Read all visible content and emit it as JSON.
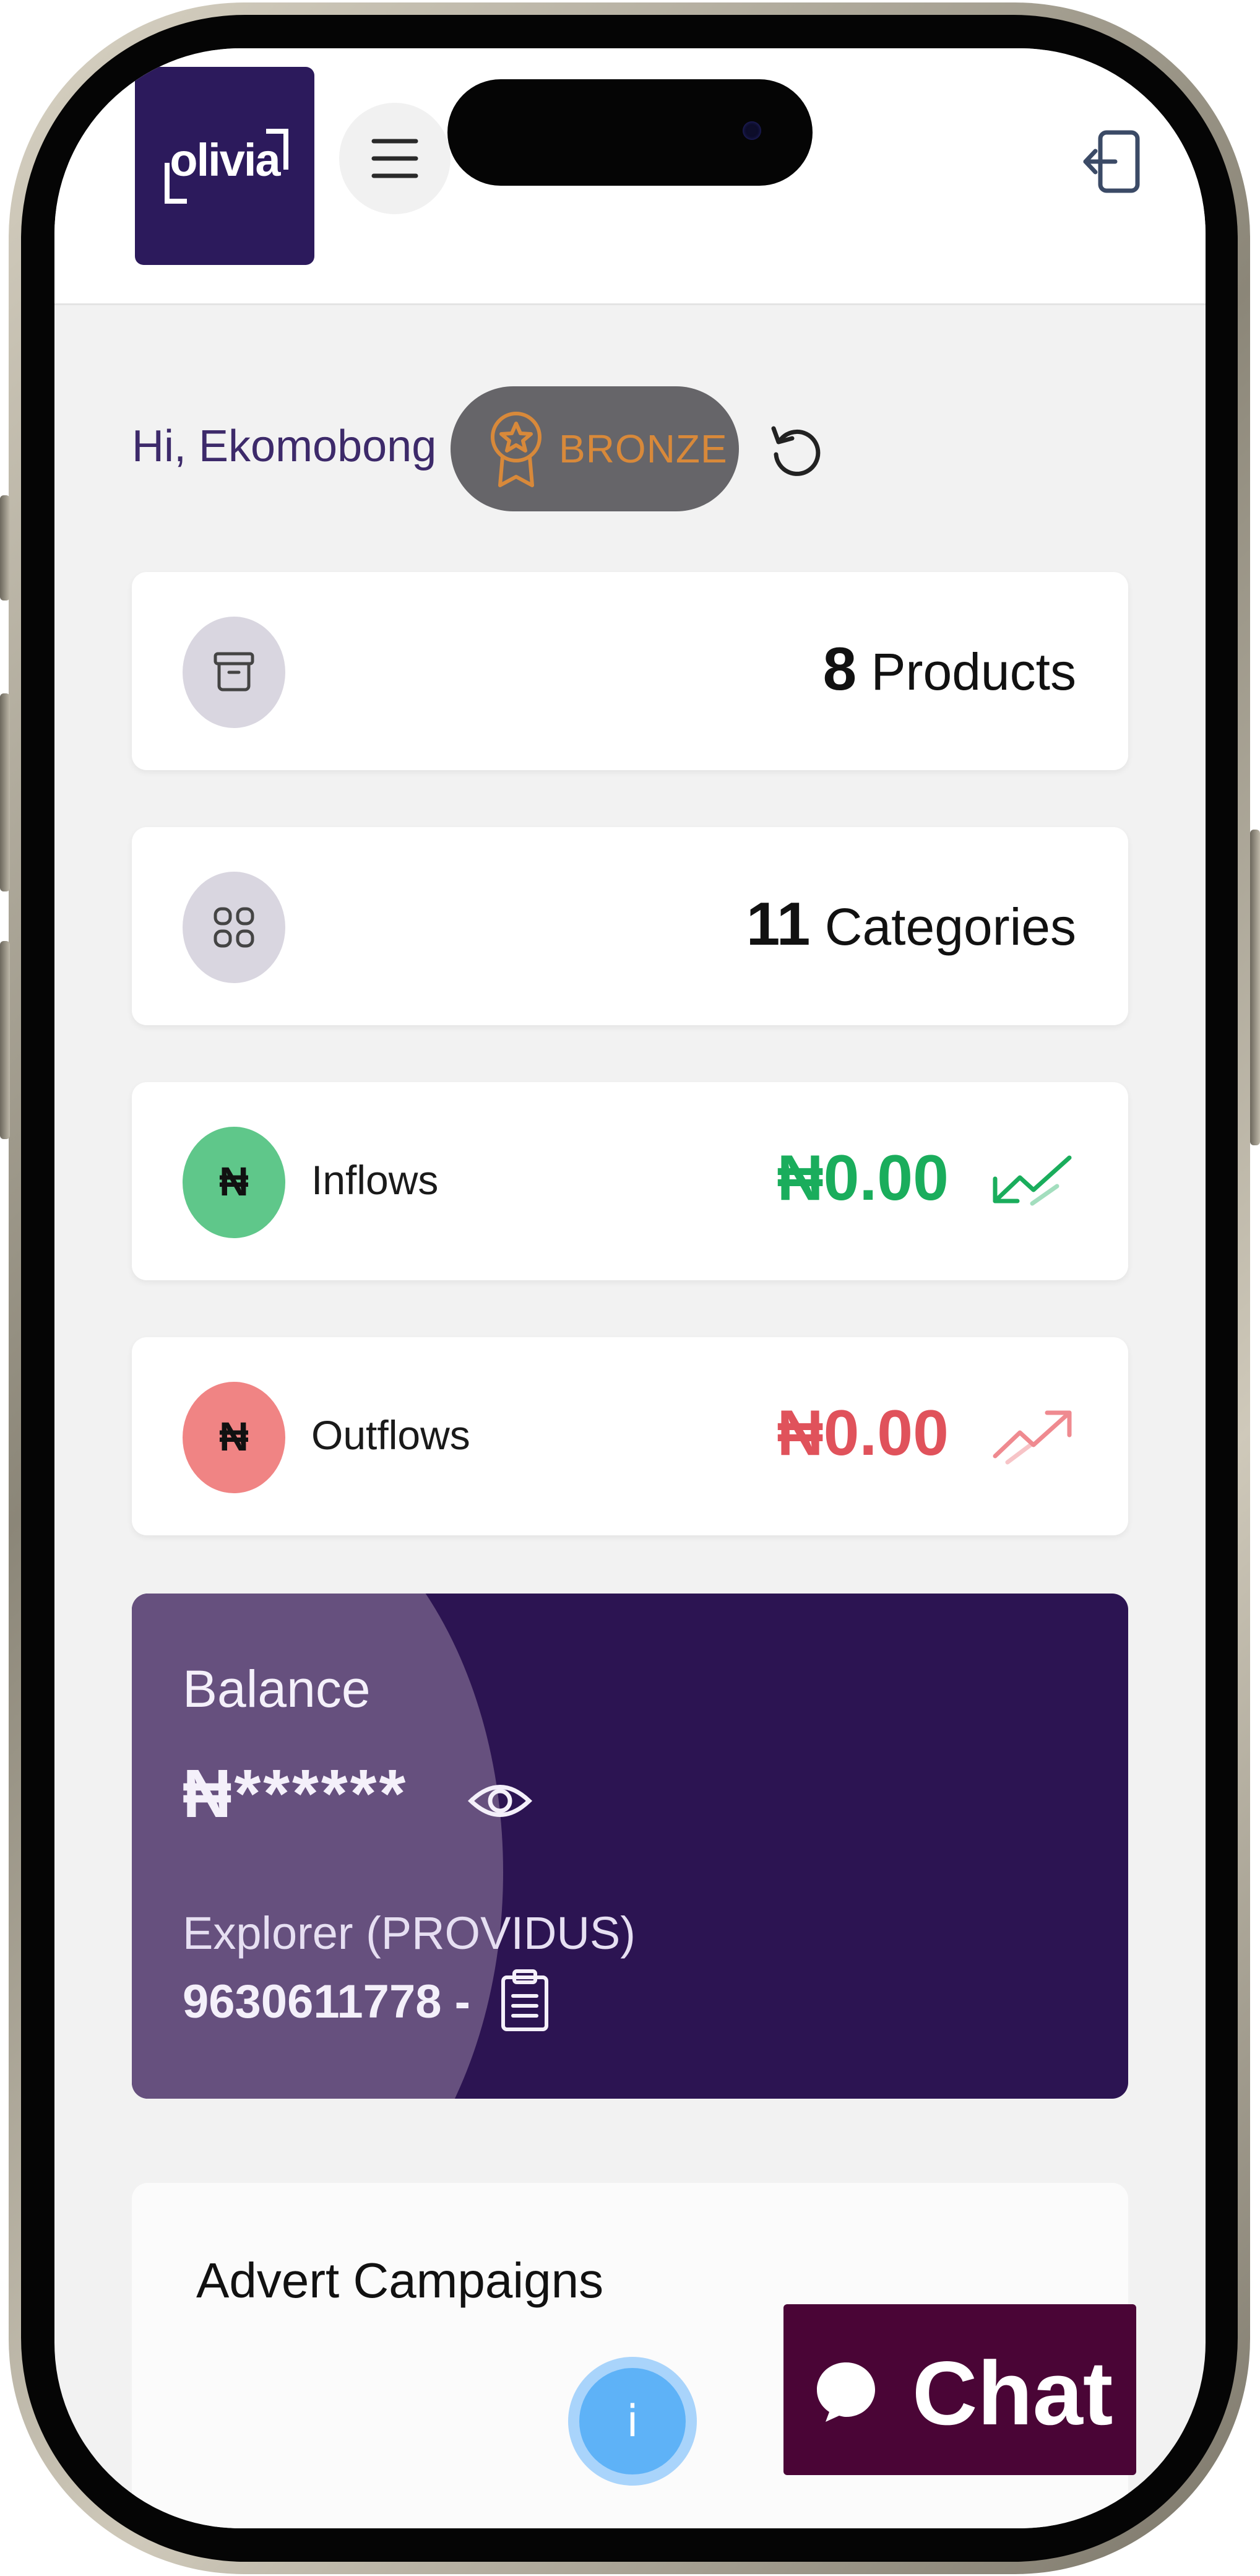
{
  "app": {
    "logo_text": "olivia"
  },
  "header": {
    "menu_icon": "hamburger-icon",
    "logout_icon": "logout-icon"
  },
  "greeting": {
    "text": "Hi, Ekomobong",
    "badge_label": "BRONZE",
    "badge_icon": "medal-icon",
    "refresh_icon": "refresh-icon"
  },
  "stats": {
    "products": {
      "count": "8",
      "label": "Products",
      "icon": "archive-icon"
    },
    "categories": {
      "count": "11",
      "label": "Categories",
      "icon": "grid-icon"
    }
  },
  "flows": {
    "inflows": {
      "label": "Inflows",
      "currency_symbol": "₦",
      "amount": "₦0.00",
      "color": "#1aad5c",
      "icon": "trend-down-icon"
    },
    "outflows": {
      "label": "Outflows",
      "currency_symbol": "₦",
      "amount": "₦0.00",
      "color": "#e0525b",
      "icon": "trend-up-icon"
    }
  },
  "balance": {
    "label": "Balance",
    "masked_amount": "₦******",
    "bank": "Explorer (PROVIDUS)",
    "account": "9630611778 -",
    "eye_icon": "eye-icon",
    "copy_icon": "clipboard-icon"
  },
  "advert": {
    "title": "Advert Campaigns"
  },
  "floating": {
    "info_label": "i",
    "chat_label": "Chat",
    "chat_icon": "chat-bubble-icon"
  }
}
